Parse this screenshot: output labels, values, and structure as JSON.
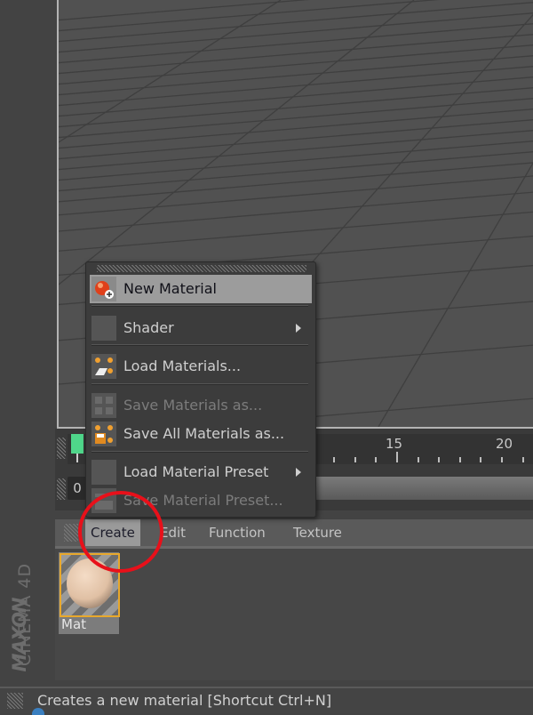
{
  "viewport": {
    "name": "3D viewport",
    "grid": "perspective floor grid"
  },
  "timeline": {
    "ruler_labels": [
      "15",
      "20"
    ],
    "current_frame": "0",
    "marker_color": "#4fd68a"
  },
  "material_manager": {
    "menu": [
      {
        "label": "Create",
        "active": true
      },
      {
        "label": "Edit",
        "active": false
      },
      {
        "label": "Function",
        "active": false
      },
      {
        "label": "Texture",
        "active": false
      }
    ],
    "materials": [
      {
        "name": "Mat",
        "selected": true
      }
    ]
  },
  "create_menu": {
    "items": [
      {
        "label": "New Material",
        "icon": "new-material-icon",
        "highlighted": true,
        "disabled": false,
        "submenu": false
      },
      {
        "label": "Shader",
        "icon": "blank-icon",
        "highlighted": false,
        "disabled": false,
        "submenu": true
      },
      {
        "label": "Load Materials...",
        "icon": "load-materials-icon",
        "highlighted": false,
        "disabled": false,
        "submenu": false
      },
      {
        "label": "Save Materials as...",
        "icon": "save-materials-icon",
        "highlighted": false,
        "disabled": true,
        "submenu": false
      },
      {
        "label": "Save All Materials as...",
        "icon": "save-all-materials-icon",
        "highlighted": false,
        "disabled": false,
        "submenu": false
      },
      {
        "label": "Load Material Preset",
        "icon": "blank-icon",
        "highlighted": false,
        "disabled": false,
        "submenu": true
      },
      {
        "label": "Save Material Preset...",
        "icon": "save-preset-icon",
        "highlighted": false,
        "disabled": true,
        "submenu": false
      }
    ]
  },
  "branding": {
    "company": "MAXON",
    "product": "CINEMA 4D"
  },
  "status_bar": {
    "text": "Creates a new material [Shortcut Ctrl+N]"
  },
  "annotation": {
    "color": "#e8101a",
    "target": "Create menu"
  }
}
